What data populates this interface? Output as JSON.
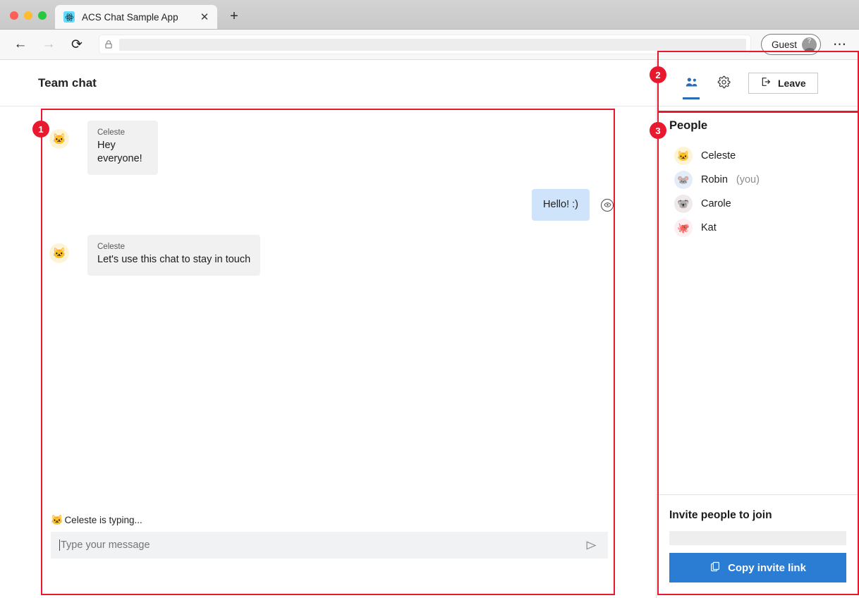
{
  "browser": {
    "tab": {
      "title": "ACS Chat Sample App",
      "favicon": "react-atom-icon",
      "close": "✕"
    },
    "new_tab": "+",
    "nav": {
      "back": "←",
      "forward": "→",
      "reload": "⟳"
    },
    "address": {
      "value": "",
      "lock": "lock-icon"
    },
    "profile": {
      "label": "Guest",
      "avatar_glyph": "?"
    },
    "menu": "⋯"
  },
  "chat": {
    "title": "Team chat",
    "messages": [
      {
        "sender": "Celeste",
        "text": "Hey everyone!",
        "avatar": "🐱",
        "avatar_class": "cat",
        "mine": false
      },
      {
        "sender": "",
        "text": "Hello! :)",
        "avatar": "",
        "avatar_class": "",
        "mine": true,
        "status": "seen"
      },
      {
        "sender": "Celeste",
        "text": "Let's use this chat to stay in touch",
        "avatar": "🐱",
        "avatar_class": "cat",
        "mine": false
      }
    ],
    "typing": {
      "emoji": "🐱",
      "text": "Celeste is typing..."
    },
    "composer": {
      "value": "",
      "placeholder": "Type your message",
      "send": "send-icon"
    }
  },
  "side": {
    "tabs": [
      {
        "name": "people-tab",
        "glyph": "👥",
        "active": true
      },
      {
        "name": "settings-tab",
        "glyph": "⚙",
        "active": false
      }
    ],
    "leave": {
      "label": "Leave",
      "icon": "leave-icon"
    },
    "people_title": "People",
    "people": [
      {
        "name": "Celeste",
        "you": "",
        "avatar": "🐱",
        "avatar_class": "cat"
      },
      {
        "name": "Robin",
        "you": "(you)",
        "avatar": "🐭",
        "avatar_class": "mouse"
      },
      {
        "name": "Carole",
        "you": "",
        "avatar": "🐨",
        "avatar_class": "koala"
      },
      {
        "name": "Kat",
        "you": "",
        "avatar": "🐙",
        "avatar_class": "octopus"
      }
    ],
    "invite": {
      "title": "Invite people to join",
      "link_value": "",
      "copy_label": "Copy invite link",
      "copy_icon": "copy-icon"
    }
  },
  "annotations": [
    {
      "id": "1",
      "label": "1"
    },
    {
      "id": "2",
      "label": "2"
    },
    {
      "id": "3",
      "label": "3"
    }
  ],
  "colors": {
    "accent_blue": "#2b7cd3",
    "tab_active_blue": "#2b6cb8",
    "annotation_red": "#e8182f",
    "incoming_bubble": "#f1f1f1",
    "outgoing_bubble": "#cfe4fa"
  }
}
